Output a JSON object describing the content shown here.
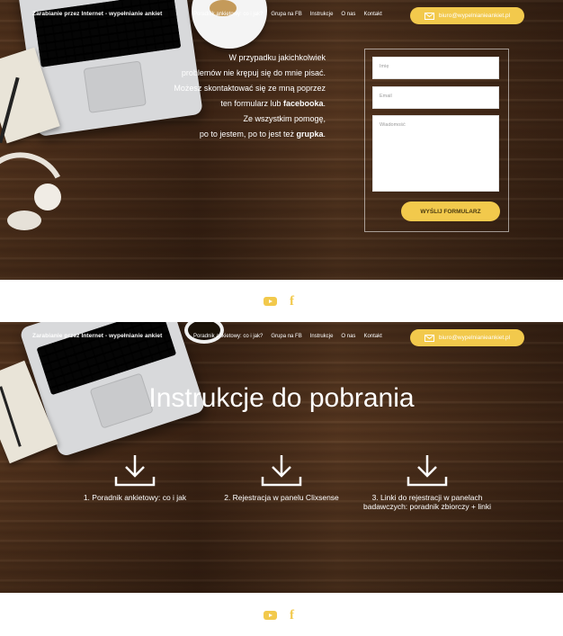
{
  "nav": {
    "brand": "Zarabianie przez Internet - wypełnianie ankiet",
    "links": [
      "Poradnik ankietowy: co i jak?",
      "Grupa na FB",
      "Instrukcje",
      "O nas",
      "Kontakt"
    ],
    "email": "biuro@wypelnianieankiet.pl"
  },
  "contact": {
    "line1": "W przypadku jakichkolwiek",
    "line2": "problemów nie krępuj się do mnie pisać.",
    "line3": "Możesz skontaktować się ze mną poprzez",
    "line4_pre": "ten formularz lub ",
    "line4_bold": "facebooka",
    "line4_post": ".",
    "line5": "Ze wszystkim pomogę,",
    "line6_pre": "po to jestem, po to jest też ",
    "line6_bold": "grupka",
    "line6_post": "."
  },
  "form": {
    "name_placeholder": "Imię",
    "email_placeholder": "Email",
    "message_placeholder": "Wiadomość",
    "submit_label": "WYŚLIJ FORMULARZ"
  },
  "downloads": {
    "title": "Instrukcje do pobrania",
    "items": [
      {
        "label": "1. Poradnik ankietowy: co i jak"
      },
      {
        "label": "2. Rejestracja w panelu Clixsense"
      },
      {
        "label": "3. Linki do rejestracji w panelach badawczych: poradnik zbiorczy + linki"
      }
    ]
  },
  "social": {
    "youtube": "youtube-icon",
    "facebook": "f"
  },
  "colors": {
    "accent": "#f2c94c",
    "wood": "#4a2e1b"
  }
}
